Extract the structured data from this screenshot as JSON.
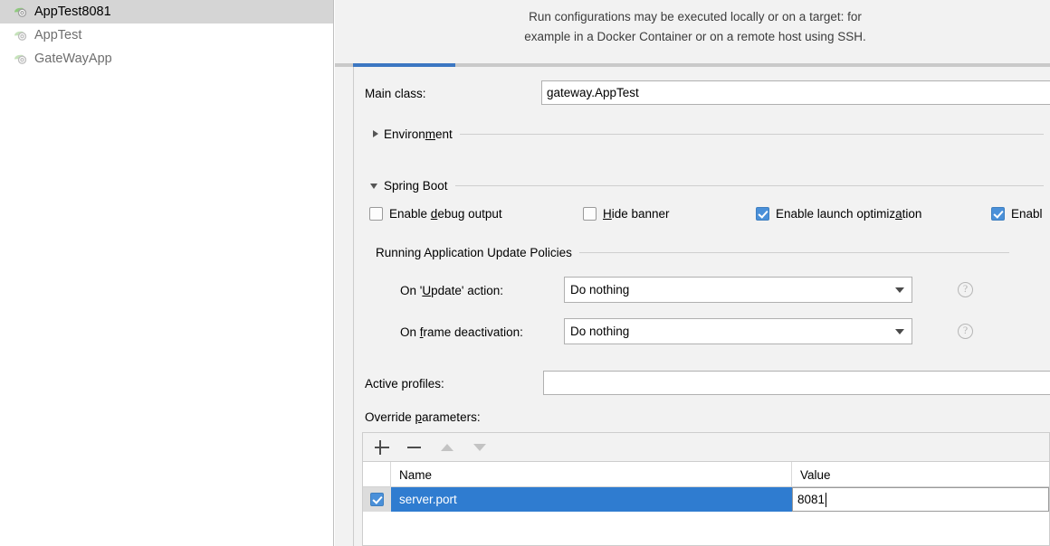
{
  "sidebar": {
    "items": [
      {
        "label": "AppTest8081",
        "icon": "spring-boot-icon",
        "selected": true
      },
      {
        "label": "AppTest",
        "icon": "spring-boot-icon",
        "selected": false
      },
      {
        "label": "GateWayApp",
        "icon": "spring-boot-icon",
        "selected": false
      }
    ]
  },
  "panel": {
    "description_line1": "Run configurations may be executed locally or on a target: for",
    "description_line2": "example in a Docker Container or on a remote host using SSH.",
    "tab_accent_color": "#3c77c2"
  },
  "main_class": {
    "label": "Main class:",
    "value": "gateway.AppTest",
    "placeholder": ""
  },
  "sections": {
    "environment": {
      "label": "Environment",
      "mnemonic": "m",
      "expanded": false
    },
    "spring_boot": {
      "label": "Spring Boot",
      "mnemonic": "g",
      "expanded": true
    }
  },
  "checkboxes": [
    {
      "label": "Enable debug output",
      "pre": "Enable ",
      "mnemonic": "d",
      "post": "ebug output",
      "checked": false
    },
    {
      "label": "Hide banner",
      "pre": "",
      "mnemonic": "H",
      "post": "ide banner",
      "checked": false
    },
    {
      "label": "Enable launch optimization",
      "pre": "Enable launch optimiz",
      "mnemonic": "a",
      "post": "tion",
      "checked": true
    },
    {
      "label": "Enabl",
      "pre": "Enabl",
      "mnemonic": "",
      "post": "",
      "checked": true
    }
  ],
  "update_policies": {
    "group_label": "Running Application Update Policies",
    "on_update": {
      "label_pre": "On '",
      "label_mnemonic": "U",
      "label_post": "pdate' action:",
      "value": "Do nothing",
      "help": "?"
    },
    "on_frame_deactivation": {
      "label_pre": "On ",
      "label_mnemonic": "f",
      "label_post": "rame deactivation:",
      "value": "Do nothing",
      "help": "?"
    }
  },
  "active_profiles": {
    "label": "Active profiles:",
    "value": "",
    "placeholder": ""
  },
  "override_parameters": {
    "label_pre": "Override ",
    "label_mnemonic": "p",
    "label_post": "arameters:",
    "toolbar": [
      {
        "name": "add-button",
        "glyph": "+",
        "enabled": true
      },
      {
        "name": "remove-button",
        "glyph": "−",
        "enabled": true
      },
      {
        "name": "move-up-button",
        "glyph": "▲",
        "enabled": false
      },
      {
        "name": "move-down-button",
        "glyph": "▼",
        "enabled": false
      }
    ],
    "columns": [
      "Name",
      "Value"
    ],
    "rows": [
      {
        "enabled": true,
        "name": "server.port",
        "value": "8081",
        "selected": true,
        "editing": true
      }
    ]
  }
}
